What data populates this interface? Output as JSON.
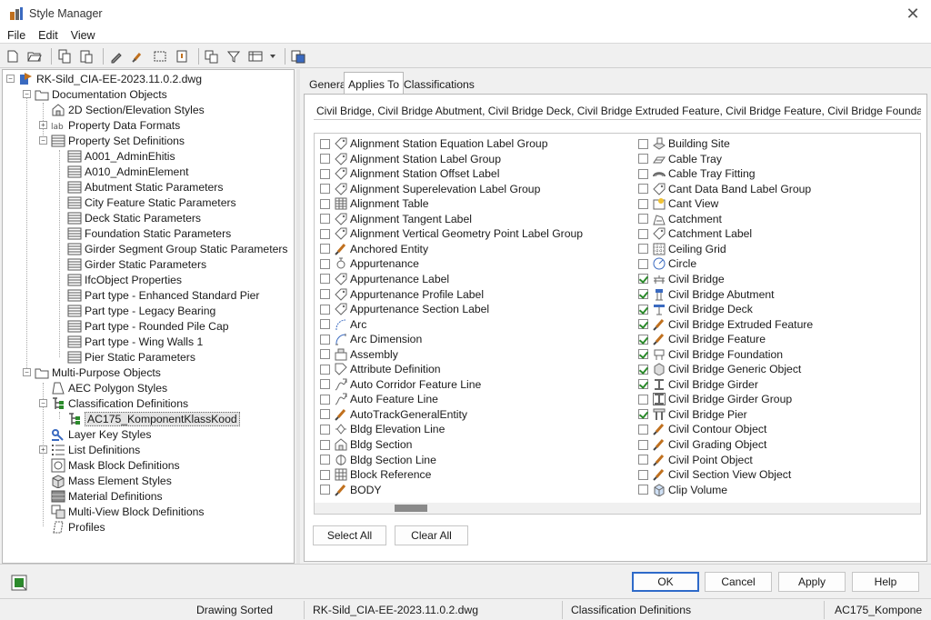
{
  "window": {
    "title": "Style Manager",
    "close_glyph": "✕"
  },
  "menu": [
    "File",
    "Edit",
    "View"
  ],
  "toolbar": [
    "new-drawing-icon",
    "open-drawing-icon",
    "copy-icon",
    "paste-icon",
    "edit-style-icon",
    "purge-icon",
    "set-from-icon",
    "sort-icon",
    "toggle-view-icon",
    "filter-icon",
    "view-mode-icon",
    "chevron-down-icon",
    "help-icon"
  ],
  "tree": {
    "root": "RK-Sild_CIA-EE-2023.11.0.2.dwg",
    "documentation": "Documentation Objects",
    "section_elevation": "2D Section/Elevation Styles",
    "property_data_formats": "Property Data Formats",
    "property_set_definitions": "Property Set Definitions",
    "psets": [
      "A001_AdminEhitis",
      "A010_AdminElement",
      "Abutment Static Parameters",
      "City Feature Static Parameters",
      "Deck Static Parameters",
      "Foundation Static Parameters",
      "Girder Segment Group Static Parameters",
      "Girder Static Parameters",
      "IfcObject Properties",
      "Part type - Enhanced Standard Pier",
      "Part type - Legacy Bearing",
      "Part type - Rounded Pile Cap",
      "Part type - Wing Walls 1",
      "Pier Static Parameters"
    ],
    "multi_purpose": "Multi-Purpose Objects",
    "aec_polygon": "AEC Polygon Styles",
    "classification_definitions": "Classification Definitions",
    "classification_item": "AC175_KomponentKlassKood",
    "layer_key": "Layer Key Styles",
    "list_definitions": "List Definitions",
    "mask_block": "Mask Block Definitions",
    "mass_element": "Mass Element Styles",
    "material_definitions": "Material Definitions",
    "multi_view_block": "Multi-View Block Definitions",
    "profiles": "Profiles"
  },
  "tabs": [
    "General",
    "Applies To",
    "Classifications"
  ],
  "summary": "Civil Bridge, Civil Bridge Abutment, Civil Bridge Deck, Civil Bridge Extruded Feature, Civil Bridge Feature, Civil Bridge Foundation, Civil Brid...",
  "objects_left": [
    {
      "label": "Alignment Station Equation Label Group",
      "checked": false,
      "icon": "label-tag-icon"
    },
    {
      "label": "Alignment Station Label Group",
      "checked": false,
      "icon": "label-tag-icon"
    },
    {
      "label": "Alignment Station Offset Label",
      "checked": false,
      "icon": "label-tag-icon"
    },
    {
      "label": "Alignment Superelevation Label Group",
      "checked": false,
      "icon": "label-tag-icon"
    },
    {
      "label": "Alignment Table",
      "checked": false,
      "icon": "table-icon"
    },
    {
      "label": "Alignment Tangent Label",
      "checked": false,
      "icon": "label-tag-icon"
    },
    {
      "label": "Alignment Vertical Geometry Point Label Group",
      "checked": false,
      "icon": "label-tag-icon"
    },
    {
      "label": "Anchored Entity",
      "checked": false,
      "icon": "brush-icon"
    },
    {
      "label": "Appurtenance",
      "checked": false,
      "icon": "appurtenance-icon"
    },
    {
      "label": "Appurtenance Label",
      "checked": false,
      "icon": "label-tag-icon"
    },
    {
      "label": "Appurtenance Profile Label",
      "checked": false,
      "icon": "label-tag-icon"
    },
    {
      "label": "Appurtenance Section Label",
      "checked": false,
      "icon": "label-tag-icon"
    },
    {
      "label": "Arc",
      "checked": false,
      "icon": "arc-icon"
    },
    {
      "label": "Arc Dimension",
      "checked": false,
      "icon": "arc-dimension-icon"
    },
    {
      "label": "Assembly",
      "checked": false,
      "icon": "assembly-icon"
    },
    {
      "label": "Attribute Definition",
      "checked": false,
      "icon": "attribute-icon"
    },
    {
      "label": "Auto Corridor Feature Line",
      "checked": false,
      "icon": "feature-line-icon"
    },
    {
      "label": "Auto Feature Line",
      "checked": false,
      "icon": "feature-line-icon"
    },
    {
      "label": "AutoTrackGeneralEntity",
      "checked": false,
      "icon": "brush-icon"
    },
    {
      "label": "Bldg Elevation Line",
      "checked": false,
      "icon": "elevation-line-icon"
    },
    {
      "label": "Bldg Section",
      "checked": false,
      "icon": "bldg-section-icon"
    },
    {
      "label": "Bldg Section Line",
      "checked": false,
      "icon": "section-line-icon"
    },
    {
      "label": "Block Reference",
      "checked": false,
      "icon": "block-icon"
    },
    {
      "label": "BODY",
      "checked": false,
      "icon": "brush-icon"
    }
  ],
  "objects_right": [
    {
      "label": "Building Site",
      "checked": false,
      "icon": "building-site-icon"
    },
    {
      "label": "Cable Tray",
      "checked": false,
      "icon": "cable-tray-icon"
    },
    {
      "label": "Cable Tray Fitting",
      "checked": false,
      "icon": "cable-tray-fitting-icon"
    },
    {
      "label": "Cant Data Band Label Group",
      "checked": false,
      "icon": "label-tag-icon"
    },
    {
      "label": "Cant View",
      "checked": false,
      "icon": "cant-view-icon"
    },
    {
      "label": "Catchment",
      "checked": false,
      "icon": "catchment-icon"
    },
    {
      "label": "Catchment Label",
      "checked": false,
      "icon": "label-tag-icon"
    },
    {
      "label": "Ceiling Grid",
      "checked": false,
      "icon": "ceiling-grid-icon"
    },
    {
      "label": "Circle",
      "checked": false,
      "icon": "circle-icon"
    },
    {
      "label": "Civil Bridge",
      "checked": true,
      "icon": "bridge-icon"
    },
    {
      "label": "Civil Bridge Abutment",
      "checked": true,
      "icon": "abutment-icon"
    },
    {
      "label": "Civil Bridge Deck",
      "checked": true,
      "icon": "deck-icon"
    },
    {
      "label": "Civil Bridge Extruded Feature",
      "checked": true,
      "icon": "brush-icon"
    },
    {
      "label": "Civil Bridge Feature",
      "checked": true,
      "icon": "brush-icon"
    },
    {
      "label": "Civil Bridge Foundation",
      "checked": true,
      "icon": "foundation-icon"
    },
    {
      "label": "Civil Bridge Generic Object",
      "checked": true,
      "icon": "generic-object-icon"
    },
    {
      "label": "Civil Bridge Girder",
      "checked": true,
      "icon": "girder-icon"
    },
    {
      "label": "Civil Bridge Girder Group",
      "checked": false,
      "icon": "girder-group-icon"
    },
    {
      "label": "Civil Bridge Pier",
      "checked": true,
      "icon": "pier-icon"
    },
    {
      "label": "Civil Contour Object",
      "checked": false,
      "icon": "brush-icon"
    },
    {
      "label": "Civil Grading Object",
      "checked": false,
      "icon": "brush-icon"
    },
    {
      "label": "Civil Point Object",
      "checked": false,
      "icon": "brush-icon"
    },
    {
      "label": "Civil Section View Object",
      "checked": false,
      "icon": "brush-icon"
    },
    {
      "label": "Clip Volume",
      "checked": false,
      "icon": "clip-volume-icon"
    }
  ],
  "buttons": {
    "select_all": "Select All",
    "clear_all": "Clear All",
    "ok": "OK",
    "cancel": "Cancel",
    "apply": "Apply",
    "help": "Help"
  },
  "status": {
    "sort": "Drawing Sorted",
    "drawing": "RK-Sild_CIA-EE-2023.11.0.2.dwg",
    "category": "Classification Definitions",
    "item": "AC175_Kompone"
  },
  "colors": {
    "accent": "#2e6ac9",
    "check": "#2b8a2b",
    "brush": "#c0701e",
    "icon_gray": "#666666"
  }
}
